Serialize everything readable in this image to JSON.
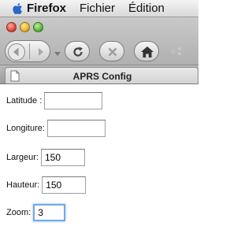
{
  "menubar": {
    "app_name": "Firefox",
    "items": [
      "Fichier",
      "Édition"
    ]
  },
  "tab": {
    "title": "APRS Config"
  },
  "form": {
    "latitude_label": "Latitude :",
    "latitude_value": "",
    "longitude_label": "Longiture:",
    "longitude_value": "",
    "width_label": "Largeur:",
    "width_value": "150",
    "height_label": "Hauteur:",
    "height_value": "150",
    "zoom_label": "Zoom:",
    "zoom_value": "3"
  },
  "icons": {
    "apple": "apple-logo-icon",
    "back": "back-arrow-icon",
    "forward": "forward-arrow-icon",
    "reload": "reload-icon",
    "stop": "stop-icon",
    "home": "home-icon",
    "page": "page-icon"
  },
  "colors": {
    "focus_ring": "#78a8e0"
  }
}
